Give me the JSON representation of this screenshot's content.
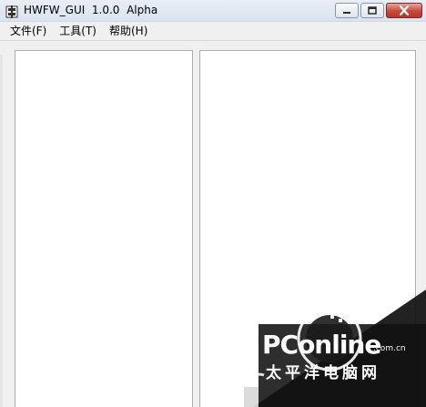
{
  "window": {
    "title": "HWFW_GUI  1.0.0  Alpha",
    "icon": "app-window-icon"
  },
  "menu": {
    "items": [
      "文件(F)",
      "工具(T)",
      "帮助(H)"
    ]
  },
  "watermark": {
    "brand": "PConline",
    "domain": ".com.cn",
    "chinese": "太平洋电脑网"
  }
}
